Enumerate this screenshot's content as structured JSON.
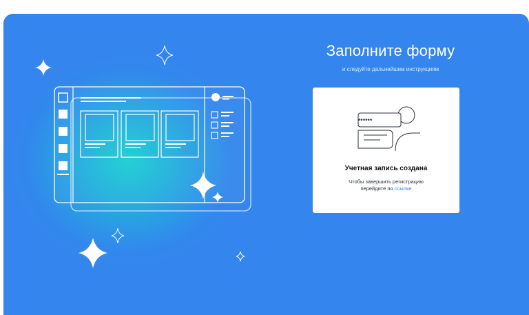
{
  "form": {
    "title": "Заполните форму",
    "subtitle": "и следуйте дальнейшим инструкциям"
  },
  "card": {
    "password_mask": "******",
    "title": "Учетная запись создана",
    "text_line1": "Чтобы завершить регистрацию",
    "text_line2_prefix": "перейдите по",
    "link_text": "ссылке"
  },
  "icons": {
    "illustration": "browser-window-illustration",
    "sparkle": "sparkle-icon",
    "account": "user-password-icon"
  },
  "colors": {
    "background": "#3585ee",
    "glow": "#1ad3d2",
    "card": "#ffffff",
    "link": "#2d7ff0"
  }
}
